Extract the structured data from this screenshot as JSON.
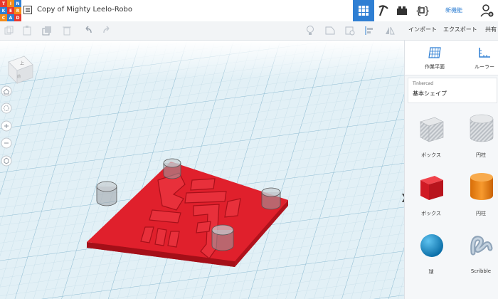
{
  "app": {
    "logo_letters": [
      "T",
      "I",
      "N",
      "K",
      "E",
      "R",
      "C",
      "A",
      "D"
    ],
    "logo_colors": [
      "#e8392d",
      "#f28b1a",
      "#2f7fd3",
      "#2f7fd3",
      "#e8392d",
      "#f28b1a",
      "#f28b1a",
      "#2f7fd3",
      "#e8392d"
    ],
    "design_title": "Copy of Mighty Leelo-Robo",
    "new_feature": "新機能"
  },
  "toolbar": {
    "import_label": "インポート",
    "export_label": "エクスポート",
    "share_label": "共有"
  },
  "panel": {
    "workplane_label": "作業平面",
    "ruler_label": "ルーラー",
    "library_category": "Tinkercad",
    "library_name": "基本シェイプ",
    "shapes": [
      {
        "label": "ボックス",
        "icon": "striped-box-icon"
      },
      {
        "label": "円柱",
        "icon": "striped-cylinder-icon"
      },
      {
        "label": "ボックス",
        "icon": "red-box-icon"
      },
      {
        "label": "円柱",
        "icon": "orange-cylinder-icon"
      },
      {
        "label": "球",
        "icon": "blue-sphere-icon"
      },
      {
        "label": "Scribble",
        "icon": "scribble-icon"
      }
    ]
  },
  "viewcube": {
    "top_label": "上",
    "front_label": "前"
  },
  "colors": {
    "accent": "#2f7fd3",
    "model_red": "#e0202c",
    "grid_bg": "#dfeef5"
  }
}
